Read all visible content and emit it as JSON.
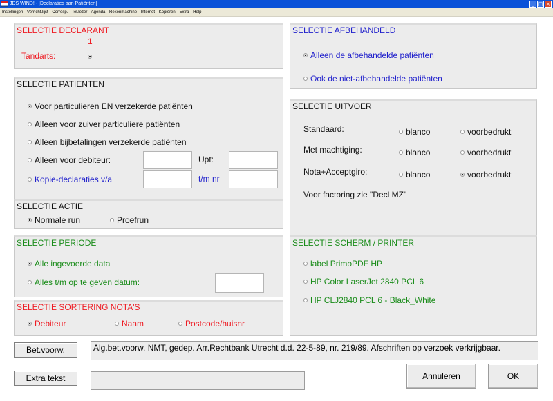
{
  "window": {
    "title": "JDS WIND! - [Declaraties aan Patiënten]",
    "controls": [
      "_",
      "□",
      "×"
    ]
  },
  "menu": [
    "Instellingen",
    "Verricht.lijst",
    "Corresp.",
    "Tel.lezer",
    "Agenda",
    "Rekenmachine",
    "Internet",
    "Kopiëren",
    "Extra",
    "Help"
  ],
  "declarant": {
    "title": "SELECTIE DECLARANT",
    "number": "1",
    "tandarts_label": "Tandarts:"
  },
  "afbehandeld": {
    "title": "SELECTIE AFBEHANDELD",
    "options": [
      "Alleen de afbehandelde patiënten",
      "Ook de niet-afbehandelde patiënten"
    ],
    "selected": 0
  },
  "patienten": {
    "title": "SELECTIE PATIENTEN",
    "options": [
      "Voor particulieren EN verzekerde patiënten",
      "Alleen voor zuiver particuliere patiënten",
      "Alleen bijbetalingen verzekerde patiënten",
      "Alleen voor debiteur:",
      "Kopie-declaraties v/a"
    ],
    "selected": 0,
    "upt_label": "Upt:",
    "tm_nr_label": "t/m nr"
  },
  "uitvoer": {
    "title": "SELECTIE UITVOER",
    "rows": [
      {
        "label": "Standaard:",
        "opt1": "blanco",
        "opt2": "voorbedrukt"
      },
      {
        "label": "Met machtiging:",
        "opt1": "blanco",
        "opt2": "voorbedrukt"
      },
      {
        "label": "Nota+Acceptgiro:",
        "opt1": "blanco",
        "opt2": "voorbedrukt"
      }
    ],
    "selected": [
      "none",
      "none",
      "voorbedrukt"
    ],
    "factoring_note": "Voor factoring zie \"Decl MZ\""
  },
  "actie": {
    "title": "SELECTIE ACTIE",
    "options": [
      "Normale run",
      "Proefrun"
    ],
    "selected": 0
  },
  "periode": {
    "title": "SELECTIE PERIODE",
    "options": [
      "Alle ingevoerde data",
      "Alles t/m op te geven datum:"
    ],
    "selected": 0
  },
  "printer": {
    "title": "SELECTIE SCHERM / PRINTER",
    "options": [
      "label PrimoPDF HP",
      "HP Color LaserJet 2840 PCL 6",
      "HP CLJ2840 PCL 6 - Black_White"
    ]
  },
  "sortering": {
    "title": "SELECTIE SORTERING NOTA'S",
    "options": [
      "Debiteur",
      "Naam",
      "Postcode/huisnr"
    ],
    "selected": 0
  },
  "footer": {
    "betvoorw_label": "Bet.voorw.",
    "betvoorw_text": "Alg.bet.voorw. NMT, gedep. Arr.Rechtbank Utrecht d.d. 22-5-89, nr. 219/89. Afschriften op verzoek verkrijgbaar.",
    "extra_label": "Extra tekst",
    "extra_value": "",
    "annuleren_label": "Annuleren",
    "ok_label": "OK"
  },
  "colors": {
    "panel_bg": "#ececec",
    "title_red": "#ee1c24",
    "title_blue": "#2222cc",
    "title_green": "#1a8c1a",
    "titlebar": "#0a52d8"
  }
}
